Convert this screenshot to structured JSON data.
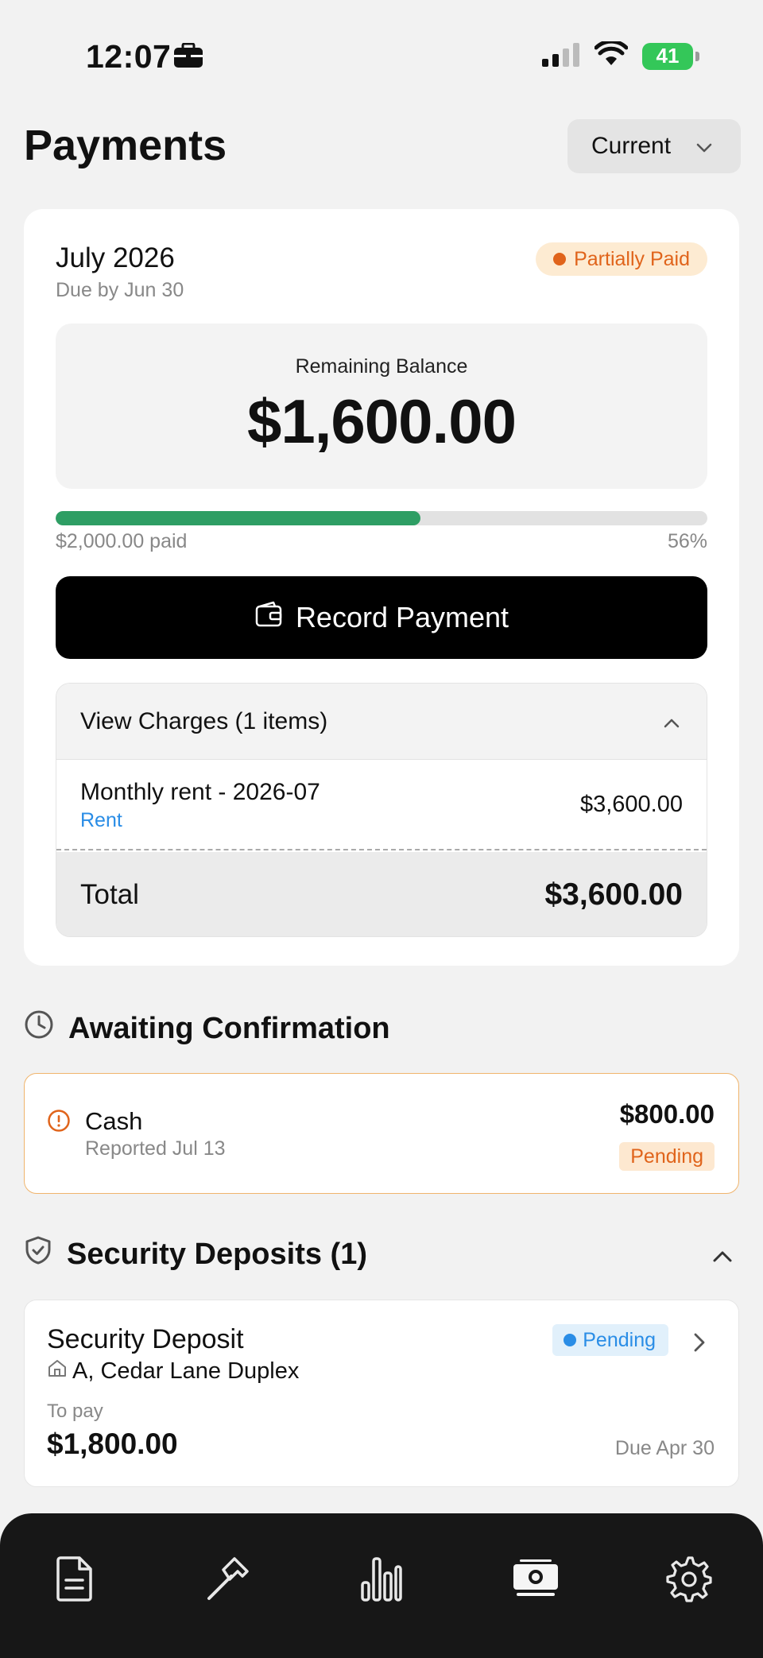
{
  "status_bar": {
    "time": "12:07",
    "battery": "41"
  },
  "header": {
    "title": "Payments",
    "period_label": "Current"
  },
  "bill": {
    "month": "July 2026",
    "due": "Due by Jun 30",
    "status": "Partially Paid",
    "balance_label": "Remaining Balance",
    "balance_amount": "$1,600.00",
    "paid_text": "$2,000.00 paid",
    "percent_text": "56%",
    "progress_fraction": 0.56,
    "record_button": "Record Payment",
    "charges": {
      "header": "View Charges (1 items)",
      "items": [
        {
          "name": "Monthly rent - 2026-07",
          "category": "Rent",
          "amount": "$3,600.00"
        }
      ],
      "total_label": "Total",
      "total_amount": "$3,600.00"
    }
  },
  "awaiting": {
    "title": "Awaiting Confirmation",
    "method": "Cash",
    "reported": "Reported Jul 13",
    "amount": "$800.00",
    "status": "Pending"
  },
  "deposits": {
    "title": "Security Deposits (1)",
    "item": {
      "title": "Security Deposit",
      "location": "A, Cedar Lane Duplex",
      "status": "Pending",
      "to_pay_label": "To pay",
      "amount": "$1,800.00",
      "due": "Due Apr 30"
    }
  },
  "tabs": [
    "document-icon",
    "hammer-icon",
    "bar-chart-icon",
    "money-icon",
    "gear-icon"
  ],
  "colors": {
    "accent_green": "#2e9e64",
    "warning_orange": "#e0641b",
    "info_blue": "#2a8de6",
    "tab_bar": "#171717"
  }
}
